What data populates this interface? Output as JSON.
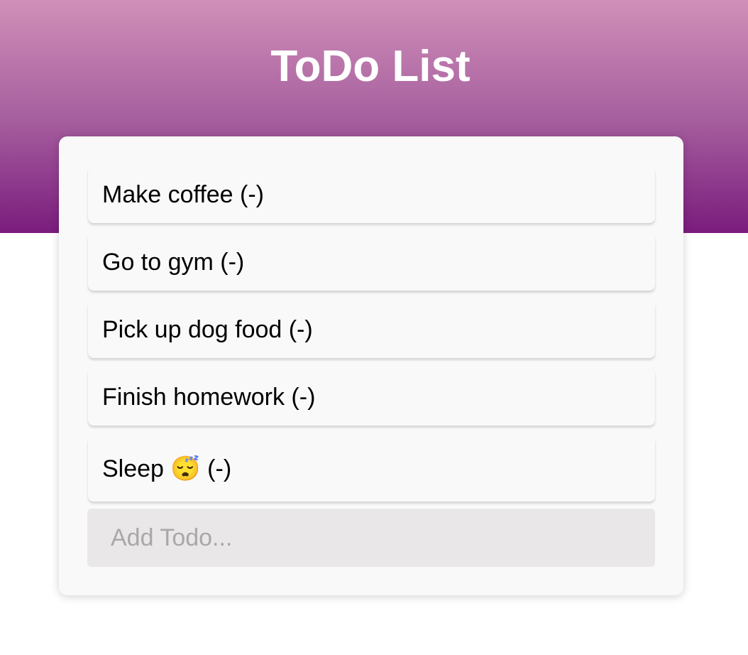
{
  "app": {
    "title": "ToDo List"
  },
  "todos": [
    {
      "label": "Make coffee (-)"
    },
    {
      "label": "Go to gym (-)"
    },
    {
      "label": "Pick up dog food (-)"
    },
    {
      "label": "Finish homework (-)"
    },
    {
      "label": "Sleep 😴 (-)"
    }
  ],
  "input": {
    "placeholder": "Add Todo...",
    "value": ""
  },
  "colors": {
    "header_gradient_top": "#d08fb8",
    "header_gradient_bottom": "#7a1c7d",
    "card_background": "#f9f9f9",
    "input_background": "#e9e7e8"
  }
}
